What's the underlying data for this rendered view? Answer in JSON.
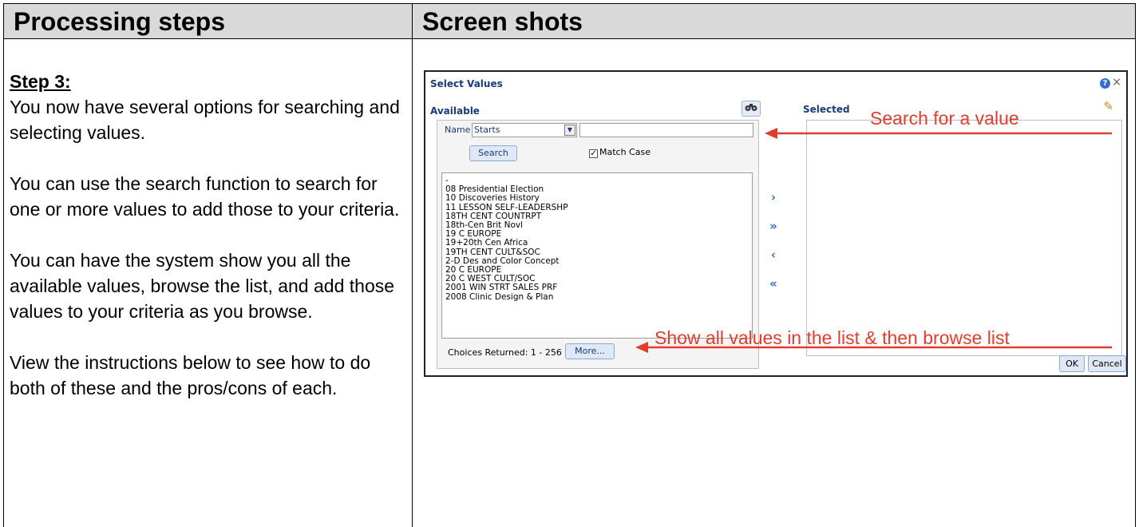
{
  "header": {
    "left_title": "Processing steps",
    "right_title": "Screen shots"
  },
  "step": {
    "title": "Step 3:",
    "paragraphs": [
      "You now have several options for searching and selecting values.",
      "You can use the search function to search for one or more values to add those to your criteria.",
      "You can have the system show you all the available values, browse the list, and add those values to your criteria as you browse.",
      "View the instructions below to see how to do both of these and the pros/cons of each."
    ]
  },
  "dialog": {
    "title": "Select Values",
    "help_glyph": "?",
    "close_glyph": "×",
    "available_label": "Available",
    "selected_label": "Selected",
    "name_label": "Name",
    "name_select_value": "Starts",
    "search_button": "Search",
    "match_case_label": "Match Case",
    "match_case_checked": true,
    "list_items": [
      "-",
      "08 Presidential Election",
      "10 Discoveries History",
      "11 LESSON SELF-LEADERSHP",
      "18TH CENT COUNTRPT",
      "18th-Cen Brit Novl",
      "19 C EUROPE",
      "19+20th Cen Africa",
      "19TH CENT CULT&SOC",
      "2-D Des and Color Concept",
      "20 C EUROPE",
      "20 C WEST CULT/SOC",
      "2001 WIN STRT SALES PRF",
      "2008 Clinic Design & Plan"
    ],
    "choices_returned": "Choices Returned: 1 - 256 +",
    "more_button": "More...",
    "ok_button": "OK",
    "cancel_button": "Cancel",
    "shuttle": {
      "move": "›",
      "move_all": "»",
      "remove": "‹",
      "remove_all": "«"
    }
  },
  "annotations": {
    "search": "Search for a value",
    "show_all": "Show all values in the list & then browse list",
    "color": "#e03c2f"
  }
}
